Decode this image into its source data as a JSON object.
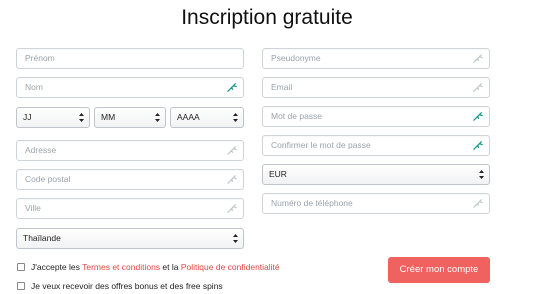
{
  "title": "Inscription gratuite",
  "left": {
    "prenom": {
      "placeholder": "Prénom"
    },
    "nom": {
      "placeholder": "Nom"
    },
    "birth": {
      "day": "JJ",
      "month": "MM",
      "year": "AAAA"
    },
    "adresse": {
      "placeholder": "Adresse"
    },
    "code_postal": {
      "placeholder": "Code postal"
    },
    "ville": {
      "placeholder": "Ville"
    },
    "pays": {
      "value": "Thaïlande"
    }
  },
  "right": {
    "pseudonyme": {
      "placeholder": "Pseudonyme"
    },
    "email": {
      "placeholder": "Email"
    },
    "mot_de_passe": {
      "placeholder": "Mot de passe"
    },
    "confirmer": {
      "placeholder": "Confirmer le mot de passe"
    },
    "devise": {
      "value": "EUR"
    },
    "telephone": {
      "placeholder": "Numéro de téléphone"
    }
  },
  "terms": {
    "prefix": "J'accepte les",
    "terms_link": "Termes et conditions",
    "middle": "et la",
    "privacy_link": "Politique de confidentialité"
  },
  "offers": {
    "label": "Je veux recevoir des offres bonus et des free spins"
  },
  "submit": {
    "label": "Créer mon compte"
  },
  "colors": {
    "accent": "#f0625f",
    "link": "#e2473f",
    "icon_active": "#1a9a8c",
    "icon_inactive": "#c3c8cc",
    "border": "#cfd4d8"
  }
}
